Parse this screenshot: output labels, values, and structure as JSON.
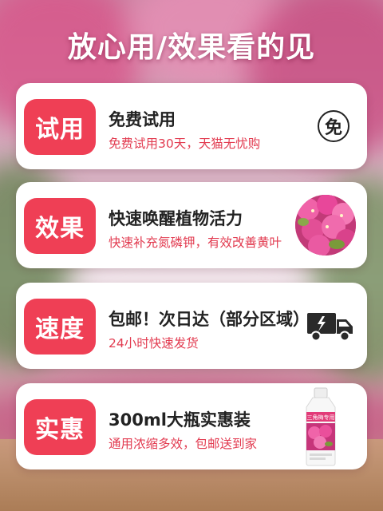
{
  "headline": "放心用/效果看的见",
  "cards": [
    {
      "tag": "试用",
      "title": "免费试用",
      "subtitle": "免费试用30天，天猫无忧购",
      "icon": "free-badge-icon",
      "icon_text": "免"
    },
    {
      "tag": "效果",
      "title": "快速唤醒植物活力",
      "subtitle": "快速补充氮磷钾，有效改善黄叶",
      "icon": "flower-photo"
    },
    {
      "tag": "速度",
      "title": "包邮！次日达（部分区域）",
      "subtitle": "24小时快速发货",
      "icon": "truck-icon"
    },
    {
      "tag": "实惠",
      "title": "300ml大瓶实惠装",
      "subtitle": "通用浓缩多效，包邮送到家",
      "icon": "bottle-photo",
      "bottle_label": "三角梅专用"
    }
  ],
  "colors": {
    "accent": "#ef3f55",
    "subtitle": "#e23b50",
    "card": "#ffffff",
    "title": "#222222"
  }
}
